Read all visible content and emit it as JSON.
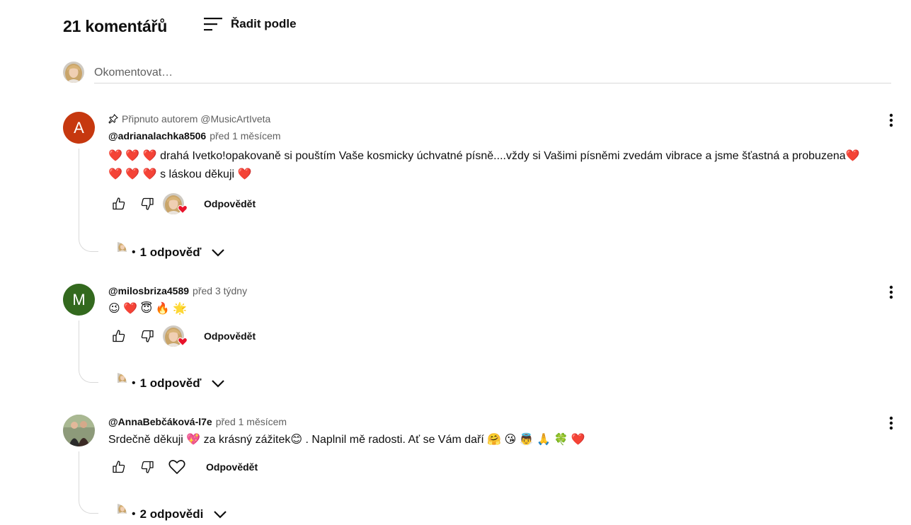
{
  "header": {
    "count": "21 komentářů",
    "sort_label": "Řadit podle"
  },
  "compose": {
    "placeholder": "Okomentovat…"
  },
  "comments": [
    {
      "pinned": "Připnuto autorem @MusicArtIveta",
      "avatar_letter": "A",
      "avatar_color": "#c6380f",
      "author": "@adrianalachka8506",
      "time": "před 1 měsícem",
      "text": "❤️ ❤️ ❤️ drahá Ivetko!opakovaně si pouštím Vaše kosmicky úchvatné písně....vždy si Vašimi písněmi zvedám vibrace a jsme šťastná a probuzena❤️ ❤️ ❤️ ❤️ s láskou děkuji ❤️",
      "reply_label": "Odpovědět",
      "replies_label": "1 odpověď",
      "dot": "•"
    },
    {
      "avatar_letter": "M",
      "avatar_color": "#33691e",
      "author": "@milosbriza4589",
      "time": "před 3 týdny",
      "text": "😉 ❤️ 😇 🔥 🌟",
      "reply_label": "Odpovědět",
      "replies_label": "1 odpověď",
      "dot": "•"
    },
    {
      "author": "@AnnaBebčáková-l7e",
      "time": "před 1 měsícem",
      "text": "Srdečně děkuji 💖  za krásný zážitek😊 . Naplnil mě radosti. Ať se Vám daří 🤗  😘  👼  🙏  🍀  ❤️",
      "reply_label": "Odpovědět",
      "replies_label": "2 odpovědi",
      "dot": "•"
    }
  ],
  "colors": {
    "heart_red": "#e8132b",
    "muted_text": "#606060",
    "divider": "#d9d9d9"
  },
  "icons": [
    "sort-icon",
    "pin-icon",
    "thumb-up-icon",
    "thumb-down-icon",
    "heart-icon",
    "more-vert-icon",
    "chevron-down-icon"
  ]
}
